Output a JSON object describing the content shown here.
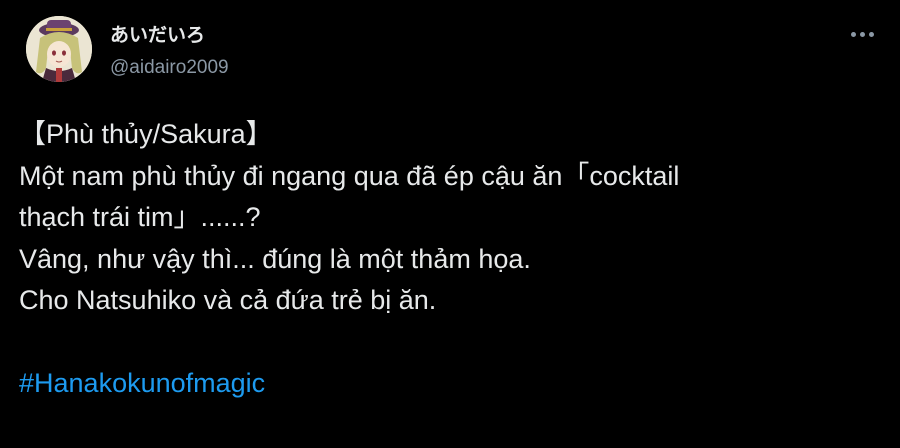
{
  "tweet": {
    "author": {
      "display_name": "あいだいろ",
      "handle": "@aidairo2009"
    },
    "more_icon": "more-horizontal-icon",
    "lines": [
      "【Phù thủy/Sakura】",
      "Một nam phù thủy đi ngang qua đã ép cậu ăn「cocktail",
      "thạch trái tim」......?",
      "Vâng, như vậy thì... đúng là một thảm họa.",
      "Cho Natsuhiko và cả đứa trẻ bị ăn."
    ],
    "hashtag": "#Hanakokunofmagic"
  },
  "colors": {
    "background": "#000000",
    "text": "#e7e9ea",
    "secondary_text": "#8b98a5",
    "link": "#1d9bf0"
  }
}
